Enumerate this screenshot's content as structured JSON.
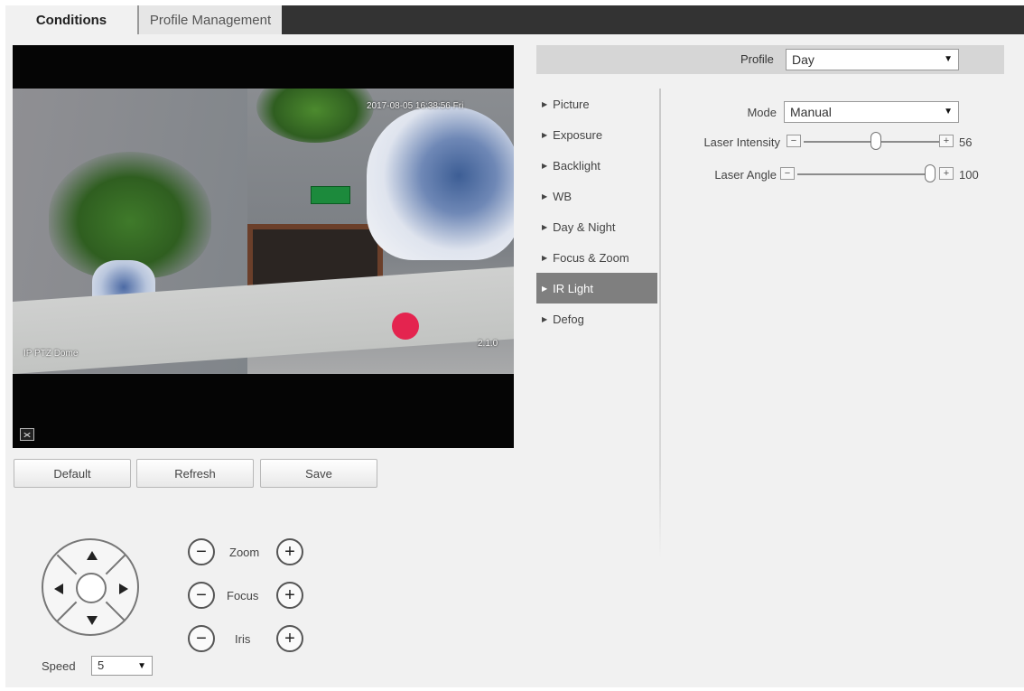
{
  "tabs": [
    {
      "label": "Conditions",
      "active": true
    },
    {
      "label": "Profile Management",
      "active": false
    }
  ],
  "video": {
    "timestamp": "2017-08-05 16:38:56 Fri",
    "camera_name": "IP PTZ Dome",
    "zoom": "2.1.0",
    "fullscreen_icon": "fullscreen-icon"
  },
  "actions": {
    "default_label": "Default",
    "refresh_label": "Refresh",
    "save_label": "Save"
  },
  "ptz": {
    "zoom_label": "Zoom",
    "focus_label": "Focus",
    "iris_label": "Iris",
    "minus": "−",
    "plus": "+",
    "speed_label": "Speed",
    "speed_value": "5"
  },
  "profile": {
    "label": "Profile",
    "value": "Day"
  },
  "menu": [
    {
      "label": "Picture",
      "active": false
    },
    {
      "label": "Exposure",
      "active": false
    },
    {
      "label": "Backlight",
      "active": false
    },
    {
      "label": "WB",
      "active": false
    },
    {
      "label": "Day & Night",
      "active": false
    },
    {
      "label": "Focus & Zoom",
      "active": false
    },
    {
      "label": "IR Light",
      "active": true
    },
    {
      "label": "Defog",
      "active": false
    }
  ],
  "settings": {
    "mode_label": "Mode",
    "mode_value": "Manual",
    "laser_intensity_label": "Laser Intensity",
    "laser_intensity_value": "56",
    "laser_angle_label": "Laser Angle",
    "laser_angle_value": "100",
    "minus_symbol": "−",
    "plus_symbol": "+"
  },
  "colors": {
    "tab_bar": "#333333",
    "active_menu": "#7f7f7f",
    "panel_bg": "#f1f1f1"
  }
}
